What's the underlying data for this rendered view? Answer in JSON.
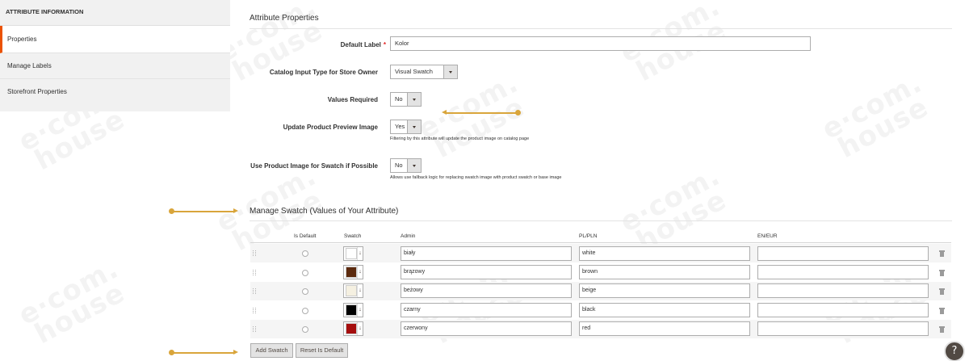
{
  "sidebar": {
    "header": "ATTRIBUTE INFORMATION",
    "items": [
      {
        "label": "Properties"
      },
      {
        "label": "Manage Labels"
      },
      {
        "label": "Storefront Properties"
      }
    ]
  },
  "attribute_properties": {
    "title": "Attribute Properties",
    "default_label": {
      "label": "Default Label",
      "required_mark": "*",
      "value": "Kolor"
    },
    "catalog_input_type": {
      "label": "Catalog Input Type for Store Owner",
      "value": "Visual Swatch"
    },
    "values_required": {
      "label": "Values Required",
      "value": "No"
    },
    "update_preview": {
      "label": "Update Product Preview Image",
      "value": "Yes",
      "note": "Filtering by this attribute will update the product image on catalog page"
    },
    "use_product_image": {
      "label": "Use Product Image for Swatch if Possible",
      "value": "No",
      "note": "Allows use fallback logic for replacing swatch image with product swatch or base image"
    }
  },
  "manage_swatch": {
    "title": "Manage Swatch (Values of Your Attribute)",
    "columns": {
      "is_default": "Is Default",
      "swatch": "Swatch",
      "admin": "Admin",
      "pl": "PL/PLN",
      "en": "EN/EUR"
    },
    "swatch_arrow": "↓",
    "rows": [
      {
        "color": "#ffffff",
        "admin": "biały",
        "pl": "white",
        "en": ""
      },
      {
        "color": "#5c2a0e",
        "admin": "brązowy",
        "pl": "brown",
        "en": ""
      },
      {
        "color": "#f5f0e1",
        "admin": "beżowy",
        "pl": "beige",
        "en": ""
      },
      {
        "color": "#000000",
        "admin": "czarny",
        "pl": "black",
        "en": ""
      },
      {
        "color": "#a50e0e",
        "admin": "czerwony",
        "pl": "red",
        "en": ""
      }
    ],
    "buttons": {
      "add": "Add Swatch",
      "reset": "Reset Is Default"
    }
  },
  "help": {
    "label": "?"
  },
  "watermark": {
    "text_top": "e·com.",
    "text_bottom": "house"
  }
}
